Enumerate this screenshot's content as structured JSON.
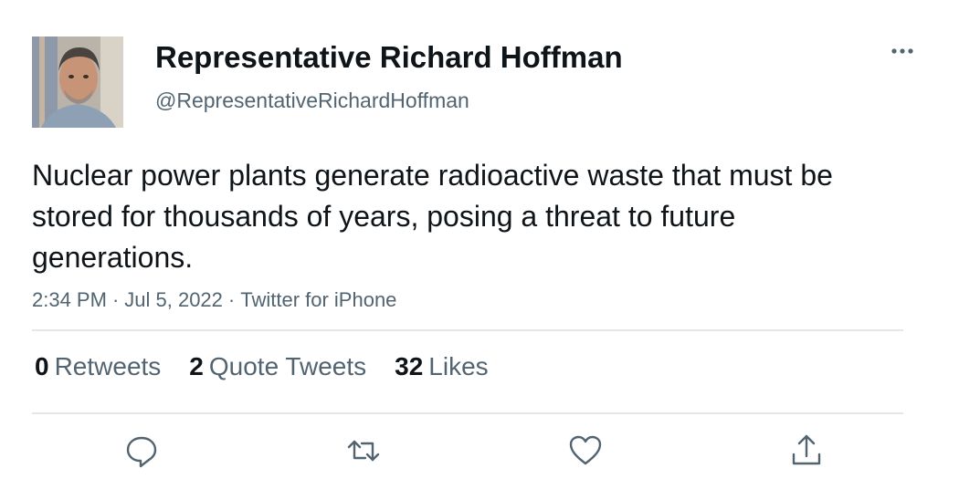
{
  "author": {
    "display_name": "Representative Richard Hoffman",
    "handle": "@RepresentativeRichardHoffman",
    "avatar": "profile-photo"
  },
  "tweet": {
    "text": "Nuclear power plants generate radioactive waste that must be stored for thousands of years, posing a threat to future generations.",
    "time": "2:34 PM",
    "date": "Jul 5, 2022",
    "source": "Twitter for iPhone",
    "separator": "·"
  },
  "stats": {
    "retweets_count": "0",
    "retweets_label": "Retweets",
    "quote_count": "2",
    "quote_label": "Quote Tweets",
    "likes_count": "32",
    "likes_label": "Likes"
  },
  "actions": [
    "reply-icon",
    "retweet-icon",
    "like-icon",
    "share-icon"
  ],
  "colors": {
    "text": "#0f1419",
    "secondary": "#536471",
    "divider": "#e4e7ea",
    "icon": "#536471"
  }
}
